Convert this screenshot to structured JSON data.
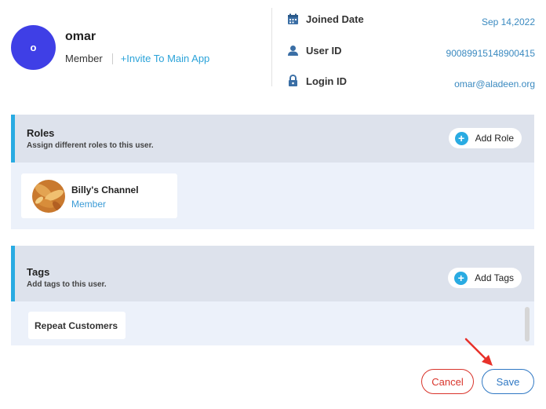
{
  "profile": {
    "avatar_initial": "o",
    "name": "omar",
    "role": "Member",
    "invite_link": "+Invite To Main App"
  },
  "info": {
    "joined_label": "Joined Date",
    "joined_value": "Sep 14,2022",
    "userid_label": "User ID",
    "userid_value": "90089915148900415",
    "login_label": "Login ID",
    "login_value": "omar@aladeen.org"
  },
  "roles": {
    "title": "Roles",
    "subtitle": "Assign different roles to this user.",
    "add_label": "Add Role",
    "items": [
      {
        "name": "Billy's Channel",
        "role": "Member"
      }
    ]
  },
  "tags": {
    "title": "Tags",
    "subtitle": "Add tags to this user.",
    "add_label": "Add Tags",
    "items": [
      "Repeat Customers"
    ]
  },
  "footer": {
    "cancel_label": "Cancel",
    "save_label": "Save"
  },
  "colors": {
    "avatar": "#3f3fe6",
    "accent": "#29abe2",
    "link": "#2ba3d9",
    "cancel": "#d9342b",
    "save": "#2f78c4",
    "annotation_arrow": "#e8312a"
  }
}
